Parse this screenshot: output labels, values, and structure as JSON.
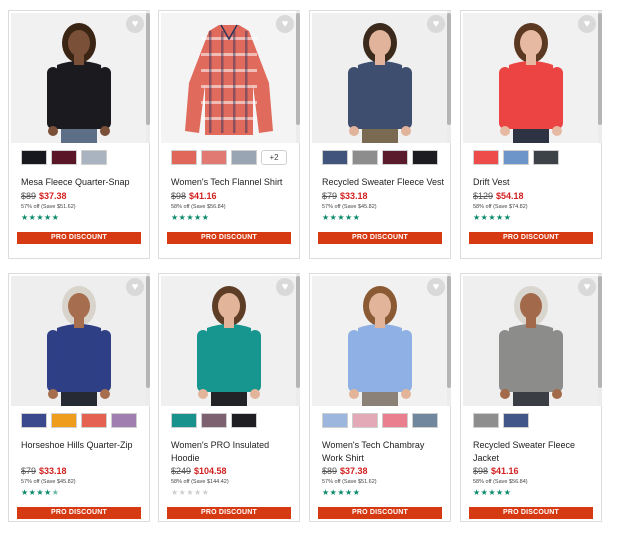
{
  "products": [
    {
      "name": "Mesa Fleece Quarter-Snap",
      "original_price": "$89",
      "sale_price": "$37.38",
      "savings": "57% off (Save $51.62)",
      "rating_stars": 5,
      "button_label": "PRO DISCOUNT",
      "swatches": [
        "#18181f",
        "#5a1526",
        "#a9b4c0"
      ],
      "more_colors": "",
      "bg": "#f1f1f1",
      "garment": "#1b1b1f",
      "skin": "#7a5038",
      "hair": "#3a2414",
      "pants": "#5c6f86"
    },
    {
      "name": "Women's Tech Flannel Shirt",
      "original_price": "$98",
      "sale_price": "$41.16",
      "savings": "58% off (Save $56.84)",
      "rating_stars": 5,
      "button_label": "PRO DISCOUNT",
      "swatches": [
        "#e2675b",
        "#e07a72",
        "#9aa5b3"
      ],
      "more_colors": "+2",
      "bg": "#f4f4f4",
      "garment": "#e06b5d",
      "skin": "",
      "hair": "",
      "pants": ""
    },
    {
      "name": "Recycled Sweater Fleece Vest",
      "original_price": "$79",
      "sale_price": "$33.18",
      "savings": "57% off (Save $45.82)",
      "rating_stars": 5,
      "button_label": "PRO DISCOUNT",
      "swatches": [
        "#41557c",
        "#8d8d8d",
        "#5a1c2c",
        "#1d1d21"
      ],
      "more_colors": "",
      "bg": "#efefef",
      "garment": "#3d4e6e",
      "skin": "#e0b39a",
      "hair": "#3b2a1c",
      "pants": "#7a6a52"
    },
    {
      "name": "Drift Vest",
      "original_price": "$129",
      "sale_price": "$54.18",
      "savings": "58% off (Save $74.82)",
      "rating_stars": 5,
      "button_label": "PRO DISCOUNT",
      "swatches": [
        "#ee4b4b",
        "#6e95c9",
        "#3c4248"
      ],
      "more_colors": "",
      "bg": "#f1f1f1",
      "garment": "#ec4343",
      "skin": "#e6b9a2",
      "hair": "#5a3822",
      "pants": "#2d3342"
    },
    {
      "name": "Horseshoe Hills Quarter-Zip",
      "original_price": "$79",
      "sale_price": "$33.18",
      "savings": "57% off (Save $45.82)",
      "rating_stars": 4.5,
      "button_label": "PRO DISCOUNT",
      "swatches": [
        "#3a4a8c",
        "#ef9d1c",
        "#e56253",
        "#a07fb0"
      ],
      "more_colors": "",
      "bg": "#eeeeee",
      "garment": "#2e3f86",
      "skin": "#a66e4e",
      "hair": "#d8d4cc",
      "pants": "#262a33"
    },
    {
      "name": "Women's PRO Insulated Hoodie",
      "original_price": "$249",
      "sale_price": "$104.58",
      "savings": "58% off (Save $144.42)",
      "rating_stars": 0,
      "button_label": "PRO DISCOUNT",
      "swatches": [
        "#19928d",
        "#7d6170",
        "#1f1f23"
      ],
      "more_colors": "",
      "bg": "#f0f0f0",
      "garment": "#16968e",
      "skin": "#e2b59b",
      "hair": "#5e3d26",
      "pants": "#222327"
    },
    {
      "name": "Women's Tech Chambray Work Shirt",
      "original_price": "$89",
      "sale_price": "$37.38",
      "savings": "57% off (Save $51.62)",
      "rating_stars": 5,
      "button_label": "PRO DISCOUNT",
      "swatches": [
        "#9cb6de",
        "#e3a9b6",
        "#ea7f8f",
        "#71879e"
      ],
      "more_colors": "",
      "bg": "#f1f1f1",
      "garment": "#8fb0e4",
      "skin": "#e2b59b",
      "hair": "#8a5a34",
      "pants": "#8c8176"
    },
    {
      "name": "Recycled Sweater Fleece Jacket",
      "original_price": "$98",
      "sale_price": "$41.16",
      "savings": "58% off (Save $56.84)",
      "rating_stars": 5,
      "button_label": "PRO DISCOUNT",
      "swatches": [
        "#8e8e8e",
        "#42568a"
      ],
      "more_colors": "",
      "bg": "#efefef",
      "garment": "#8c8c8a",
      "skin": "#a26a4a",
      "hair": "#d9d5cf",
      "pants": "#3a3d44"
    }
  ]
}
